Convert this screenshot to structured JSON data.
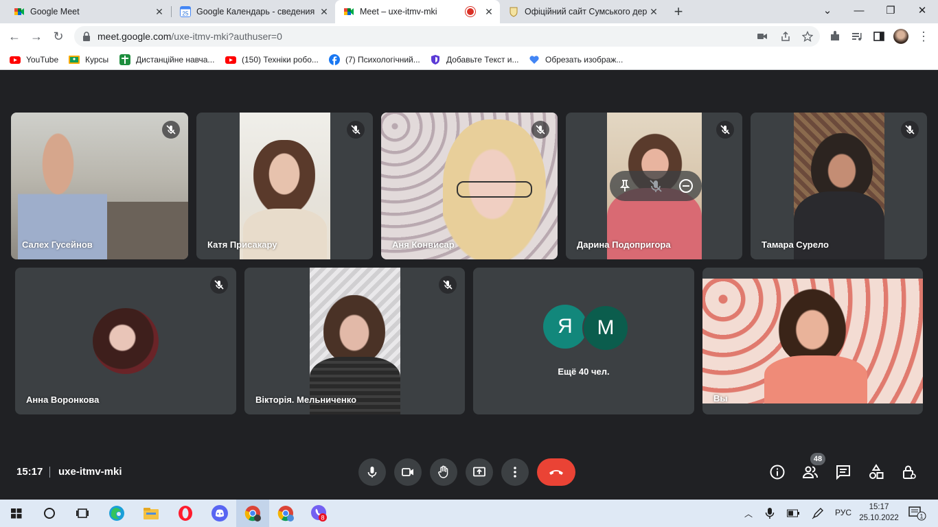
{
  "browser": {
    "tabs": [
      {
        "title": "Google Meet",
        "icon": "meet-icon"
      },
      {
        "title": "Google Календарь - сведения о",
        "icon": "calendar-icon",
        "favtext": "25"
      },
      {
        "title": "Meet – uxe-itmv-mki",
        "icon": "meet-icon",
        "recording": true,
        "active": true
      },
      {
        "title": "Офіційний сайт Сумського держ",
        "icon": "crest-icon"
      }
    ],
    "url_host": "meet.google.com",
    "url_path": "/uxe-itmv-mki?authuser=0",
    "bookmarks": [
      {
        "label": "YouTube",
        "icon": "youtube-icon"
      },
      {
        "label": "Курсы",
        "icon": "classroom-icon"
      },
      {
        "label": "Дистанційне навча...",
        "icon": "cross-icon"
      },
      {
        "label": "(150) Техніки робо...",
        "icon": "youtube-icon"
      },
      {
        "label": "(7) Психологічний...",
        "icon": "facebook-icon"
      },
      {
        "label": "Добавьте Текст и...",
        "icon": "shield-icon"
      },
      {
        "label": "Обрезать изображ...",
        "icon": "heart-icon"
      }
    ]
  },
  "participants": {
    "p1": "Салех Гусейнов",
    "p2": "Катя Присакару",
    "p3": "Аня Конвисар",
    "p4": "Дарина Подопригора",
    "p5": "Тамара Сурело",
    "p6": "Анна Воронкова",
    "p7": "Вікторія. Мельниченко",
    "more_letters": [
      "Я",
      "М"
    ],
    "more_text": "Ещё 40 чел.",
    "self": "Вы"
  },
  "meeting": {
    "time": "15:17",
    "code": "uxe-itmv-mki",
    "participant_count": "48"
  },
  "taskbar": {
    "lang": "РУС",
    "time": "15:17",
    "date": "25.10.2022",
    "viber_badge": "8",
    "notif_count": "1"
  },
  "colors": {
    "meet_bg": "#202124",
    "tile_bg": "#3c4043",
    "end_call": "#ea4335",
    "letter_ya": "#12877b",
    "letter_m": "#0b5d4d"
  }
}
